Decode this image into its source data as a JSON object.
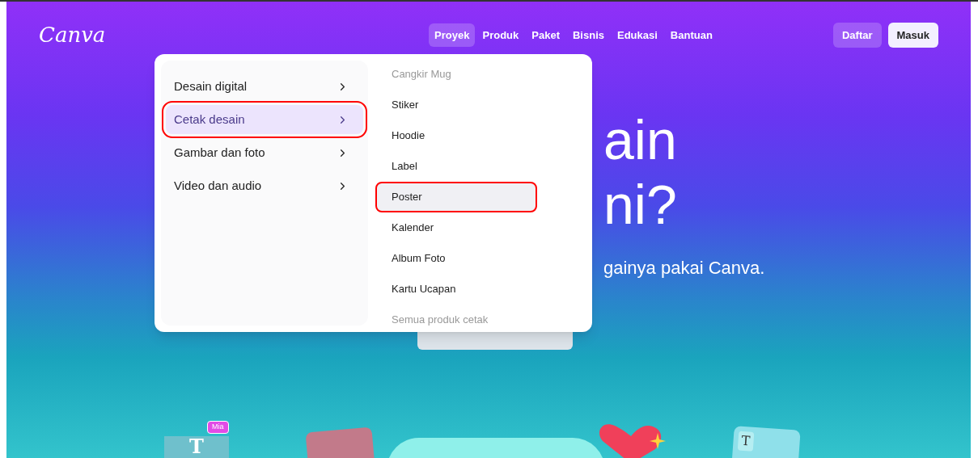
{
  "header": {
    "logo": "Canva",
    "nav": [
      {
        "label": "Proyek",
        "selected": true
      },
      {
        "label": "Produk",
        "selected": false
      },
      {
        "label": "Paket",
        "selected": false
      },
      {
        "label": "Bisnis",
        "selected": false
      },
      {
        "label": "Edukasi",
        "selected": false
      },
      {
        "label": "Bantuan",
        "selected": false
      }
    ],
    "buttons": [
      {
        "label": "Daftar",
        "kind": "secondary"
      },
      {
        "label": "Masuk",
        "kind": "primary"
      }
    ]
  },
  "hero": {
    "lines": [
      "ain",
      "ni?"
    ],
    "subtitle": "gainya pakai Canva."
  },
  "decor": {
    "tag": "Mia",
    "card_letter": "T",
    "text_letter": "T"
  },
  "menu": {
    "categories": [
      {
        "label": "Desain digital",
        "selected": false,
        "annotated": false
      },
      {
        "label": "Cetak desain",
        "selected": true,
        "annotated": true
      },
      {
        "label": "Gambar dan foto",
        "selected": false,
        "annotated": false
      },
      {
        "label": "Video dan audio",
        "selected": false,
        "annotated": false
      }
    ],
    "items": [
      {
        "label": "Cangkir Mug",
        "kind": "faded",
        "selected": false,
        "annotated": false
      },
      {
        "label": "Stiker",
        "kind": "item",
        "selected": false,
        "annotated": false
      },
      {
        "label": "Hoodie",
        "kind": "item",
        "selected": false,
        "annotated": false
      },
      {
        "label": "Label",
        "kind": "item",
        "selected": false,
        "annotated": false
      },
      {
        "label": "Poster",
        "kind": "item",
        "selected": true,
        "annotated": true
      },
      {
        "label": "Kalender",
        "kind": "item",
        "selected": false,
        "annotated": false
      },
      {
        "label": "Album Foto",
        "kind": "item",
        "selected": false,
        "annotated": false
      },
      {
        "label": "Kartu Ucapan",
        "kind": "item",
        "selected": false,
        "annotated": false
      },
      {
        "label": "Semua produk cetak",
        "kind": "faded",
        "selected": false,
        "annotated": false
      }
    ]
  }
}
